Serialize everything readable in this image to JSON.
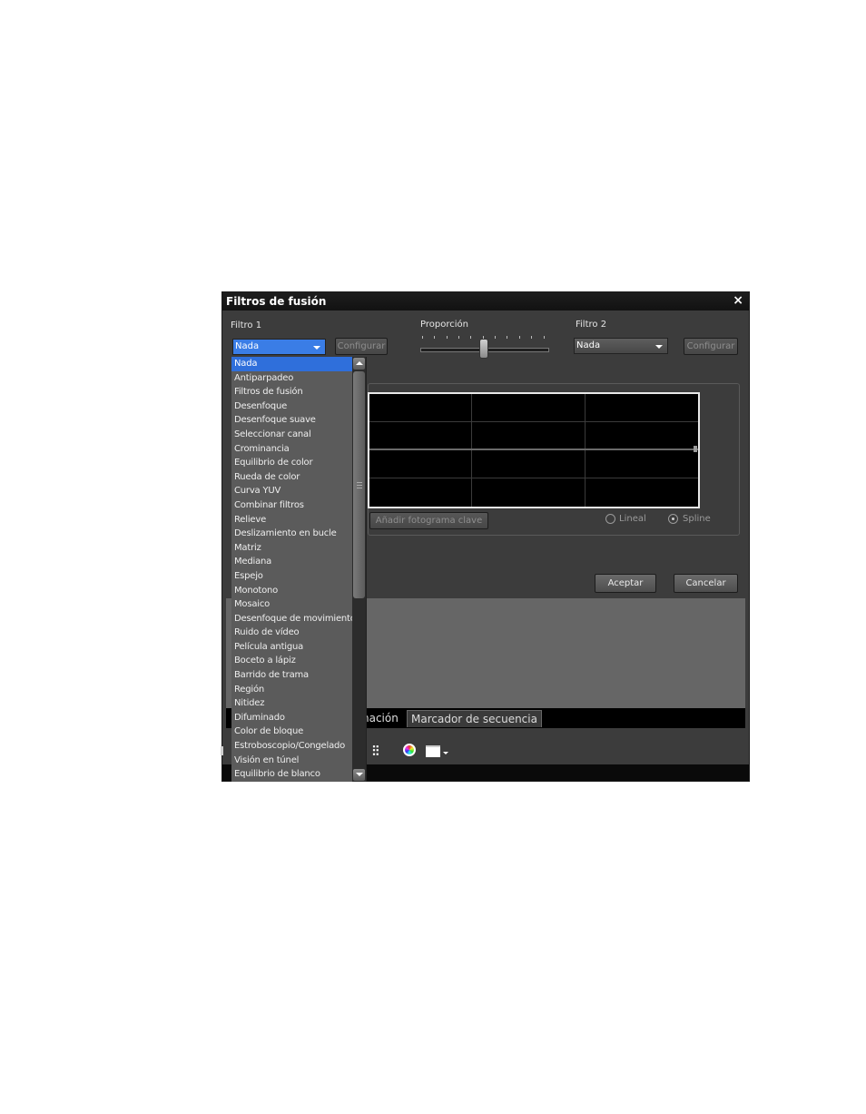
{
  "dialog": {
    "title": "Filtros de fusión",
    "close_glyph": "×"
  },
  "filter1": {
    "label": "Filtro 1",
    "selected": "Nada",
    "configure_label": "Configurar"
  },
  "ratio": {
    "label": "Proporción",
    "value_fraction": 0.5
  },
  "filter2": {
    "label": "Filtro 2",
    "selected": "Nada",
    "configure_label": "Configurar"
  },
  "graph": {
    "add_keyframe_label": "Añadir fotograma clave",
    "interpolation_options": [
      "Lineal",
      "Spline"
    ],
    "interpolation_selected": "Spline"
  },
  "buttons": {
    "ok": "Aceptar",
    "cancel": "Cancelar"
  },
  "tabs": [
    {
      "label": "nación",
      "active": false
    },
    {
      "label": "Marcador de secuencia",
      "active": true
    }
  ],
  "toolbar_icons": [
    "mixer-icon",
    "color-wheel-icon",
    "window-layout-icon"
  ],
  "dropdown": {
    "selected": "Nada",
    "items": [
      "Nada",
      "Antiparpadeo",
      "Filtros de fusión",
      "Desenfoque",
      "Desenfoque suave",
      "Seleccionar canal",
      "Crominancia",
      "Equilibrio de color",
      "Rueda de color",
      "Curva YUV",
      "Combinar filtros",
      "Relieve",
      "Deslizamiento en bucle",
      "Matriz",
      "Mediana",
      "Espejo",
      "Monotono",
      "Mosaico",
      "Desenfoque de movimiento",
      "Ruido de vídeo",
      "Película antigua",
      "Boceto a lápiz",
      "Barrido de trama",
      "Región",
      "Nitidez",
      "Difuminado",
      "Color de bloque",
      "Estroboscopio/Congelado",
      "Visión en túnel",
      "Equilibrio de blanco"
    ]
  }
}
